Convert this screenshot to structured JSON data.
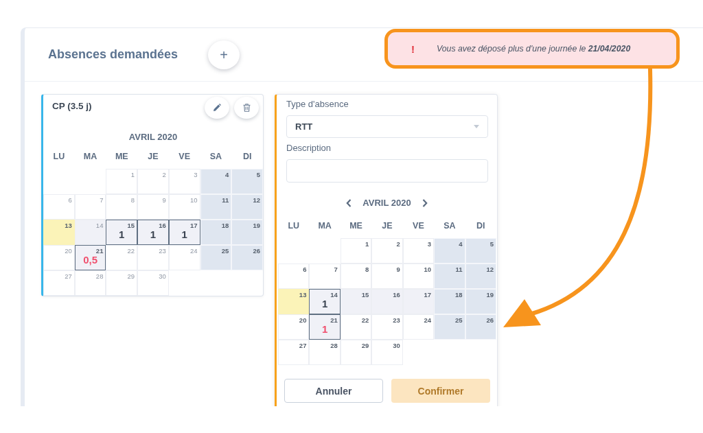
{
  "header": {
    "title": "Absences demandées",
    "add_button": "+"
  },
  "alert": {
    "icon": "!",
    "message": "Vous avez déposé plus d'une journée le **21/04/2020**"
  },
  "absence_card": {
    "title": "CP (3.5 j)",
    "calendar": {
      "month": "AVRIL 2020",
      "weekdays": [
        "LU",
        "MA",
        "ME",
        "JE",
        "VE",
        "SA",
        "DI"
      ],
      "weeks": [
        [
          {
            "kind": "blank"
          },
          {
            "kind": "blank"
          },
          {
            "day": "1",
            "kind": "workday",
            "disabled": true,
            "booked": false,
            "selected": false
          },
          {
            "day": "2",
            "kind": "workday",
            "disabled": true,
            "booked": false,
            "selected": false
          },
          {
            "day": "3",
            "kind": "workday",
            "disabled": true,
            "booked": false,
            "selected": false
          },
          {
            "day": "4",
            "kind": "weekend",
            "disabled": false,
            "booked": false,
            "selected": false
          },
          {
            "day": "5",
            "kind": "weekend",
            "disabled": false,
            "booked": false,
            "selected": false
          }
        ],
        [
          {
            "day": "6",
            "kind": "workday",
            "disabled": true,
            "booked": false,
            "selected": false
          },
          {
            "day": "7",
            "kind": "workday",
            "disabled": true,
            "booked": false,
            "selected": false
          },
          {
            "day": "8",
            "kind": "workday",
            "disabled": true,
            "booked": false,
            "selected": false
          },
          {
            "day": "9",
            "kind": "workday",
            "disabled": true,
            "booked": false,
            "selected": false
          },
          {
            "day": "10",
            "kind": "workday",
            "disabled": true,
            "booked": false,
            "selected": false
          },
          {
            "day": "11",
            "kind": "weekend",
            "disabled": false,
            "booked": false,
            "selected": false
          },
          {
            "day": "12",
            "kind": "weekend",
            "disabled": false,
            "booked": false,
            "selected": false
          }
        ],
        [
          {
            "day": "13",
            "kind": "holiday",
            "disabled": false,
            "booked": false,
            "selected": false
          },
          {
            "day": "14",
            "kind": "workday",
            "disabled": true,
            "booked": true,
            "selected": false
          },
          {
            "day": "15",
            "kind": "workday",
            "disabled": false,
            "booked": true,
            "selected": true,
            "amount": {
              "text": "1",
              "conflict": false
            }
          },
          {
            "day": "16",
            "kind": "workday",
            "disabled": false,
            "booked": true,
            "selected": true,
            "amount": {
              "text": "1",
              "conflict": false
            }
          },
          {
            "day": "17",
            "kind": "workday",
            "disabled": false,
            "booked": true,
            "selected": true,
            "amount": {
              "text": "1",
              "conflict": false
            }
          },
          {
            "day": "18",
            "kind": "weekend",
            "disabled": false,
            "booked": false,
            "selected": false
          },
          {
            "day": "19",
            "kind": "weekend",
            "disabled": false,
            "booked": false,
            "selected": false
          }
        ],
        [
          {
            "day": "20",
            "kind": "workday",
            "disabled": true,
            "booked": false,
            "selected": false
          },
          {
            "day": "21",
            "kind": "workday",
            "disabled": false,
            "booked": true,
            "selected": true,
            "amount": {
              "text": "0,5",
              "conflict": true
            }
          },
          {
            "day": "22",
            "kind": "workday",
            "disabled": true,
            "booked": false,
            "selected": false
          },
          {
            "day": "23",
            "kind": "workday",
            "disabled": true,
            "booked": false,
            "selected": false
          },
          {
            "day": "24",
            "kind": "workday",
            "disabled": true,
            "booked": false,
            "selected": false
          },
          {
            "day": "25",
            "kind": "weekend",
            "disabled": false,
            "booked": false,
            "selected": false
          },
          {
            "day": "26",
            "kind": "weekend",
            "disabled": false,
            "booked": false,
            "selected": false
          }
        ],
        [
          {
            "day": "27",
            "kind": "workday",
            "disabled": true,
            "booked": false,
            "selected": false
          },
          {
            "day": "28",
            "kind": "workday",
            "disabled": true,
            "booked": false,
            "selected": false
          },
          {
            "day": "29",
            "kind": "workday",
            "disabled": true,
            "booked": false,
            "selected": false
          },
          {
            "day": "30",
            "kind": "workday",
            "disabled": true,
            "booked": false,
            "selected": false
          },
          {
            "kind": "blank"
          },
          {
            "kind": "blank"
          },
          {
            "kind": "blank"
          }
        ]
      ]
    }
  },
  "request_form": {
    "type_label": "Type d'absence",
    "type_value": "RTT",
    "description_label": "Description",
    "calendar": {
      "month": "AVRIL 2020",
      "weekdays": [
        "LU",
        "MA",
        "ME",
        "JE",
        "VE",
        "SA",
        "DI"
      ],
      "weeks": [
        [
          {
            "kind": "blank"
          },
          {
            "kind": "blank"
          },
          {
            "day": "1",
            "kind": "workday",
            "disabled": false,
            "booked": false,
            "selected": false
          },
          {
            "day": "2",
            "kind": "workday",
            "disabled": false,
            "booked": false,
            "selected": false
          },
          {
            "day": "3",
            "kind": "workday",
            "disabled": false,
            "booked": false,
            "selected": false
          },
          {
            "day": "4",
            "kind": "weekend",
            "disabled": false,
            "booked": false,
            "selected": false
          },
          {
            "day": "5",
            "kind": "weekend",
            "disabled": false,
            "booked": false,
            "selected": false
          }
        ],
        [
          {
            "day": "6",
            "kind": "workday",
            "disabled": false,
            "booked": false,
            "selected": false
          },
          {
            "day": "7",
            "kind": "workday",
            "disabled": false,
            "booked": false,
            "selected": false
          },
          {
            "day": "8",
            "kind": "workday",
            "disabled": false,
            "booked": false,
            "selected": false
          },
          {
            "day": "9",
            "kind": "workday",
            "disabled": false,
            "booked": false,
            "selected": false
          },
          {
            "day": "10",
            "kind": "workday",
            "disabled": false,
            "booked": false,
            "selected": false
          },
          {
            "day": "11",
            "kind": "weekend",
            "disabled": false,
            "booked": false,
            "selected": false
          },
          {
            "day": "12",
            "kind": "weekend",
            "disabled": false,
            "booked": false,
            "selected": false
          }
        ],
        [
          {
            "day": "13",
            "kind": "holiday",
            "disabled": false,
            "booked": false,
            "selected": false
          },
          {
            "day": "14",
            "kind": "workday",
            "disabled": false,
            "booked": true,
            "selected": true,
            "amount": {
              "text": "1",
              "conflict": false
            }
          },
          {
            "day": "15",
            "kind": "workday",
            "disabled": false,
            "booked": true,
            "selected": false
          },
          {
            "day": "16",
            "kind": "workday",
            "disabled": false,
            "booked": true,
            "selected": false
          },
          {
            "day": "17",
            "kind": "workday",
            "disabled": false,
            "booked": true,
            "selected": false
          },
          {
            "day": "18",
            "kind": "weekend",
            "disabled": false,
            "booked": false,
            "selected": false
          },
          {
            "day": "19",
            "kind": "weekend",
            "disabled": false,
            "booked": false,
            "selected": false
          }
        ],
        [
          {
            "day": "20",
            "kind": "workday",
            "disabled": false,
            "booked": false,
            "selected": false
          },
          {
            "day": "21",
            "kind": "workday",
            "disabled": false,
            "booked": true,
            "selected": true,
            "amount": {
              "text": "1",
              "conflict": true
            }
          },
          {
            "day": "22",
            "kind": "workday",
            "disabled": false,
            "booked": false,
            "selected": false
          },
          {
            "day": "23",
            "kind": "workday",
            "disabled": false,
            "booked": false,
            "selected": false
          },
          {
            "day": "24",
            "kind": "workday",
            "disabled": false,
            "booked": false,
            "selected": false
          },
          {
            "day": "25",
            "kind": "weekend",
            "disabled": false,
            "booked": false,
            "selected": false
          },
          {
            "day": "26",
            "kind": "weekend",
            "disabled": false,
            "booked": false,
            "selected": false
          }
        ],
        [
          {
            "day": "27",
            "kind": "workday",
            "disabled": false,
            "booked": false,
            "selected": false
          },
          {
            "day": "28",
            "kind": "workday",
            "disabled": false,
            "booked": false,
            "selected": false
          },
          {
            "day": "29",
            "kind": "workday",
            "disabled": false,
            "booked": false,
            "selected": false
          },
          {
            "day": "30",
            "kind": "workday",
            "disabled": false,
            "booked": false,
            "selected": false
          },
          {
            "kind": "blank"
          },
          {
            "kind": "blank"
          },
          {
            "kind": "blank"
          }
        ]
      ]
    },
    "buttons": [
      {
        "label": "Annuler",
        "kind": "secondary",
        "disabled": false
      },
      {
        "label": "Confirmer",
        "kind": "primary",
        "disabled": true
      }
    ]
  }
}
